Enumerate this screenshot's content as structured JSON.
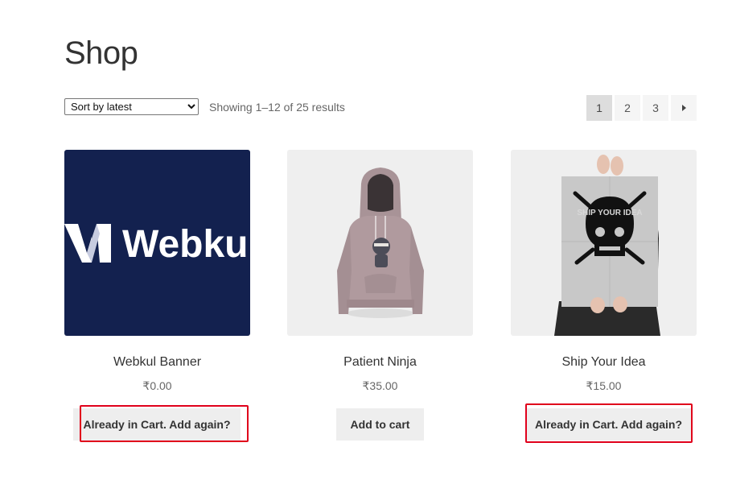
{
  "page": {
    "title": "Shop"
  },
  "toolbar": {
    "sort_selected": "Sort by latest",
    "result_count": "Showing 1–12 of 25 results",
    "pages": [
      "1",
      "2",
      "3"
    ]
  },
  "products": [
    {
      "name": "Webkul Banner",
      "price": "₹0.00",
      "button": "Already in Cart. Add again?",
      "image_text": "Webku"
    },
    {
      "name": "Patient Ninja",
      "price": "₹35.00",
      "button": "Add to cart"
    },
    {
      "name": "Ship Your Idea",
      "price": "₹15.00",
      "button": "Already in Cart. Add again?",
      "image_text": "SHIP YOUR IDEA"
    }
  ],
  "colors": {
    "banner_bg": "#13214f",
    "highlight": "#e0001b",
    "button_bg": "#eeeeee"
  },
  "icons": {
    "next_page": "triangle-right-icon"
  }
}
